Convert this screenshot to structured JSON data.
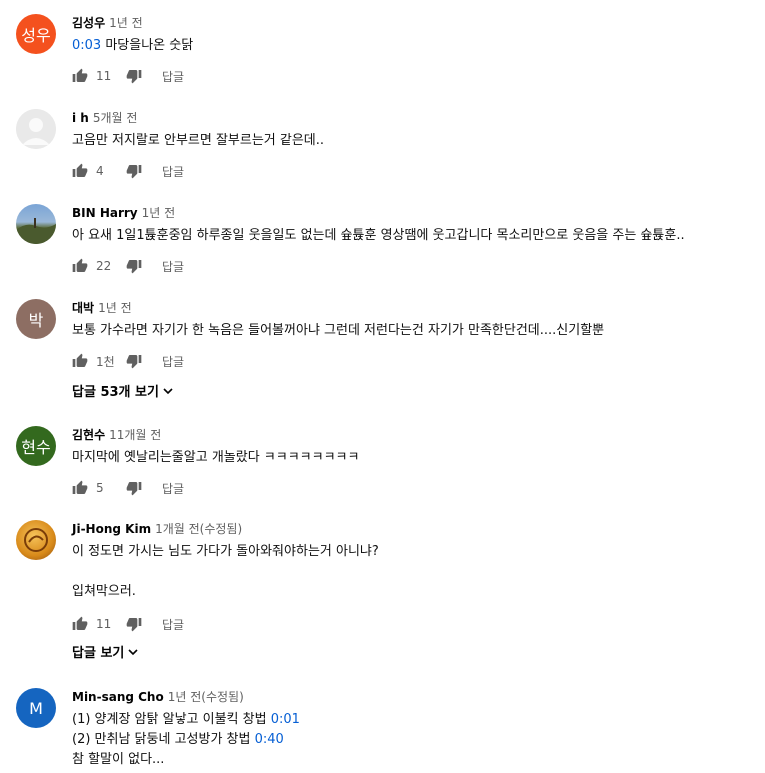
{
  "comments": [
    {
      "author": "김성우",
      "time": "1년 전",
      "avatar_text": "성우",
      "avatar_color": "#f4511e",
      "timestamp": "0:03",
      "text": " 마당을나온 숫닭",
      "likes": "11",
      "reply_label": "답글"
    },
    {
      "author": "i h",
      "time": "5개월 전",
      "avatar_text": "",
      "avatar_color": "#e0e0e0",
      "text": "고음만 저지랄로 안부르면 잘부르는거 같은데..",
      "likes": "4",
      "reply_label": "답글"
    },
    {
      "author": "BIN Harry",
      "time": "1년 전",
      "avatar_text": "",
      "avatar_color": "#6a8fb8",
      "text": "아 요새 1일1튡훈중임 하루종일 웃을일도 없는데 슢튡훈 영상땜에 웃고갑니다 목소리만으로 웃음을 주는 슢튡훈..",
      "likes": "22",
      "reply_label": "답글"
    },
    {
      "author": "대박",
      "time": "1년 전",
      "avatar_text": "박",
      "avatar_color": "#8d6e63",
      "text": "보통 가수라면 자기가 한 녹음은 들어볼꺼아냐 그런데 저런다는건 자기가 만족한단건데....신기할뿐",
      "likes": "1천",
      "reply_label": "답글",
      "view_replies": "답글 53개 보기"
    },
    {
      "author": "김현수",
      "time": "11개월 전",
      "avatar_text": "현수",
      "avatar_color": "#33691e",
      "text": "마지막에 옛날리는줄알고 개놀랐다 ㅋㅋㅋㅋㅋㅋㅋㅋ",
      "likes": "5",
      "reply_label": "답글"
    },
    {
      "author": "Ji-Hong Kim",
      "time": "1개월 전(수정됨)",
      "avatar_text": "",
      "avatar_color": "#e0a030",
      "text": "이 정도면 가시는 님도 가다가 돌아와줘야하는거 아니냐?",
      "text2": "입쳐막으러.",
      "likes": "11",
      "reply_label": "답글",
      "view_replies": "답글 보기"
    },
    {
      "author": "Min-sang Cho",
      "time": "1년 전(수정됨)",
      "avatar_text": "M",
      "avatar_color": "#1565c0",
      "line1": "(1) 양계장 암탉 알낳고 이불킥 창법 ",
      "line1_ts": "0:01",
      "line2": "(2) 만취남 닭둥네 고성방가 창법 ",
      "line2_ts": "0:40",
      "line3": "참 할말이 없다..."
    }
  ]
}
